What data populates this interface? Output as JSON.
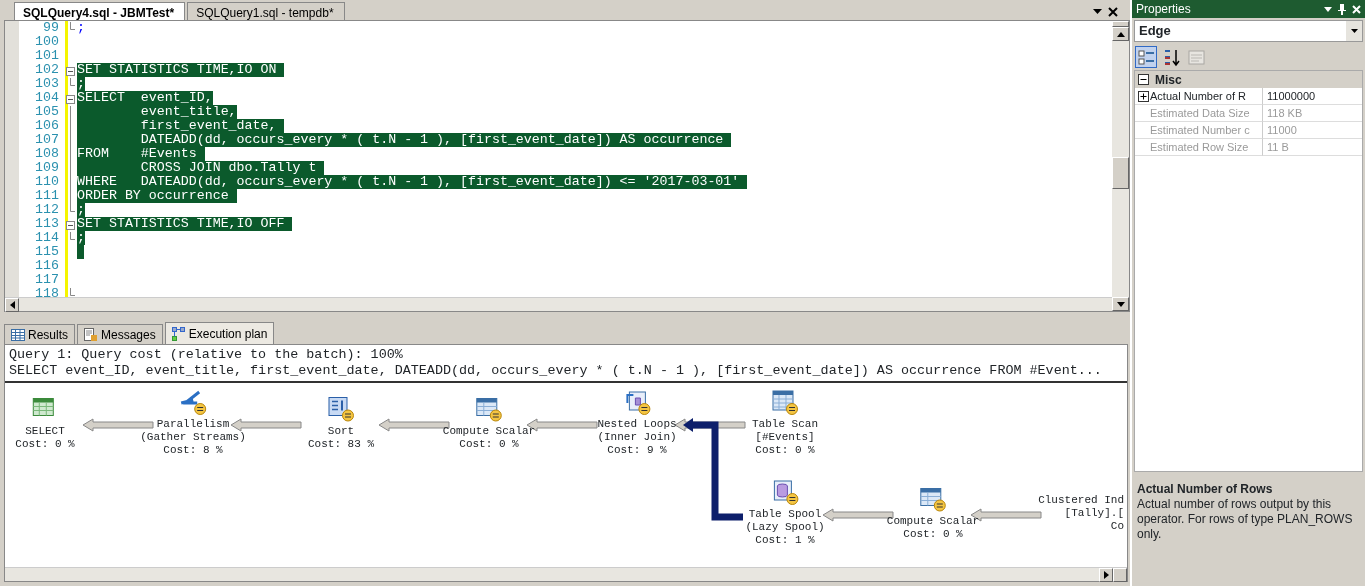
{
  "editor": {
    "tabs": [
      {
        "label": "SQLQuery4.sql - JBMTest*",
        "selected": true
      },
      {
        "label": "SQLQuery1.sql - tempdb*",
        "selected": false
      }
    ],
    "lines": [
      {
        "number": "99",
        "text": ";",
        "highlighted": false,
        "kind": "end"
      },
      {
        "number": "100",
        "kind": "plain"
      },
      {
        "number": "101",
        "kind": "plain"
      },
      {
        "number": "102",
        "text": "SET STATISTICS TIME,IO ON ",
        "highlighted": true,
        "kind": "open"
      },
      {
        "number": "103",
        "text": ";",
        "highlighted": true,
        "kind": "end"
      },
      {
        "number": "104",
        "text": "SELECT  event_ID,",
        "highlighted": true,
        "kind": "open"
      },
      {
        "number": "105",
        "text": "        event_title,",
        "highlighted": true,
        "kind": "line"
      },
      {
        "number": "106",
        "text": "        first_event_date, ",
        "highlighted": true,
        "kind": "line"
      },
      {
        "number": "107",
        "text": "        DATEADD(dd, occurs_every * ( t.N - 1 ), [first_event_date]) AS occurrence ",
        "highlighted": true,
        "kind": "line"
      },
      {
        "number": "108",
        "text": "FROM    #Events ",
        "highlighted": true,
        "kind": "line"
      },
      {
        "number": "109",
        "text": "        CROSS JOIN dbo.Tally t ",
        "highlighted": true,
        "kind": "line"
      },
      {
        "number": "110",
        "text": "WHERE   DATEADD(dd, occurs_every * ( t.N - 1 ), [first_event_date]) <= '2017-03-01' ",
        "highlighted": true,
        "kind": "line"
      },
      {
        "number": "111",
        "text": "ORDER BY occurrence ",
        "highlighted": true,
        "kind": "line"
      },
      {
        "number": "112",
        "text": ";",
        "highlighted": true,
        "kind": "end"
      },
      {
        "number": "113",
        "text": "SET STATISTICS TIME,IO OFF ",
        "highlighted": true,
        "kind": "open"
      },
      {
        "number": "114",
        "text": ";",
        "highlighted": true,
        "kind": "end"
      },
      {
        "number": "115",
        "highlighted": true,
        "kind": "plain"
      },
      {
        "number": "116",
        "kind": "plain"
      },
      {
        "number": "117",
        "kind": "plain"
      },
      {
        "number": "118",
        "kind": "end"
      }
    ]
  },
  "results": {
    "tabs": [
      {
        "label": "Results",
        "kind": "grid",
        "selected": false
      },
      {
        "label": "Messages",
        "kind": "messages",
        "selected": false
      },
      {
        "label": "Execution plan",
        "kind": "plan",
        "selected": true
      }
    ],
    "header": [
      "Query 1: Query cost (relative to the batch): 100%",
      "SELECT event_ID, event_title, first_event_date, DATEADD(dd, occurs_every * ( t.N - 1 ), [first_event_date]) AS occurrence FROM #Event..."
    ],
    "plan": {
      "label": [
        "SELECT"
      ],
      "cost": "Cost: 0 %",
      "kind": "select",
      "parallel": false,
      "children": [
        {
          "label": [
            "Parallelism",
            "(Gather Streams)"
          ],
          "cost": "Cost: 8 %",
          "kind": "parallelism",
          "parallel": true,
          "edge_selected": false,
          "children": [
            {
              "label": [
                "Sort"
              ],
              "cost": "Cost: 83 %",
              "kind": "sort",
              "parallel": true,
              "edge_selected": false,
              "children": [
                {
                  "label": [
                    "Compute Scalar"
                  ],
                  "cost": "Cost: 0 %",
                  "kind": "compute",
                  "parallel": true,
                  "edge_selected": false,
                  "children": [
                    {
                      "label": [
                        "Nested Loops",
                        "(Inner Join)"
                      ],
                      "cost": "Cost: 9 %",
                      "kind": "nested-loops",
                      "parallel": true,
                      "edge_selected": false,
                      "children": [
                        {
                          "label": [
                            "Table Scan",
                            "[#Events]"
                          ],
                          "cost": "Cost: 0 %",
                          "kind": "table-scan",
                          "parallel": true,
                          "edge_selected": false
                        },
                        {
                          "label": [
                            "Table Spool",
                            "(Lazy Spool)"
                          ],
                          "cost": "Cost: 1 %",
                          "kind": "table-spool",
                          "parallel": true,
                          "edge_selected": true,
                          "children": [
                            {
                              "label": [
                                "Compute Scalar"
                              ],
                              "cost": "Cost: 0 %",
                              "kind": "compute",
                              "parallel": true,
                              "edge_selected": false,
                              "children": [
                                {
                                  "label": [
                                    "Clustered Ind",
                                    "[Tally].["
                                  ],
                                  "cost": "Co",
                                  "kind": "cut",
                                  "edge_selected": false
                                }
                              ]
                            }
                          ]
                        }
                      ]
                    }
                  ]
                }
              ]
            }
          ]
        }
      ]
    }
  },
  "properties": {
    "title": "Properties",
    "object": "Edge",
    "toolbar": [
      {
        "kind": "categorized",
        "selected": true,
        "disabled": false
      },
      {
        "kind": "alphabetical",
        "selected": false,
        "disabled": false
      },
      {
        "kind": "pages",
        "selected": false,
        "disabled": true
      }
    ],
    "category": {
      "label": "Misc",
      "expanded": true
    },
    "rows": [
      {
        "name": "Actual Number of R",
        "value": "11000000",
        "disabled": false,
        "expandable": true
      },
      {
        "name": "Estimated Data Size",
        "value": "118 KB",
        "disabled": true,
        "expandable": false
      },
      {
        "name": "Estimated Number c",
        "value": "11000",
        "disabled": true,
        "expandable": false
      },
      {
        "name": "Estimated Row Size",
        "value": "11 B",
        "disabled": true,
        "expandable": false
      }
    ],
    "description": {
      "title": "Actual Number of Rows",
      "text": "Actual number of rows output by this operator. For rows of type PLAN_ROWS only."
    }
  }
}
